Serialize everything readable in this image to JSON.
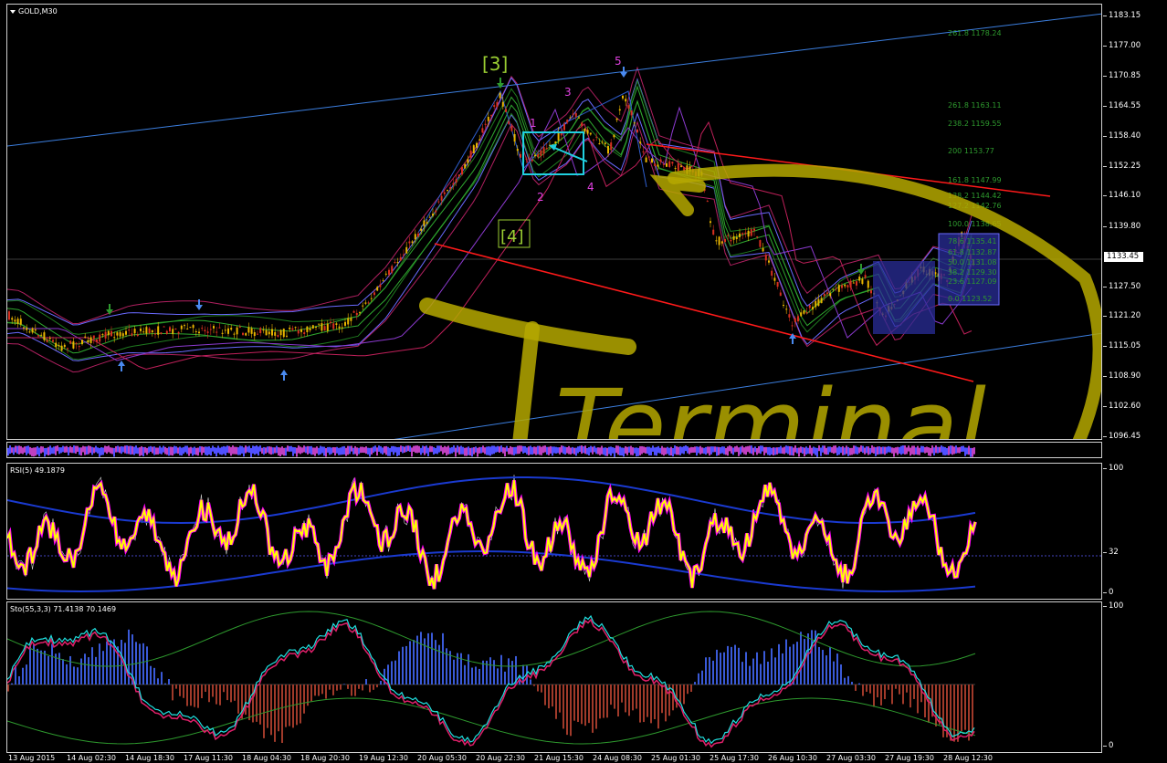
{
  "main": {
    "title": "GOLD,M30",
    "current_price": "1133.45",
    "price_ticks": [
      "1183.15",
      "1177.00",
      "1170.85",
      "1164.55",
      "1158.40",
      "1152.25",
      "1146.10",
      "1139.80",
      "1127.50",
      "1121.20",
      "1115.05",
      "1108.90",
      "1102.60",
      "1096.45"
    ],
    "wave_labels": [
      "[3]",
      "[4]",
      "1",
      "2",
      "3",
      "4",
      "5"
    ],
    "fib_labels": [
      "261.8 1178.24",
      "261.8 1163.11",
      "238.2 1159.55",
      "200 1153.77",
      "161.8 1147.99",
      "138.2 1144.42",
      "127.2 1142.76",
      "100.0 1138.65",
      "78.6 1135.41",
      "61.8 1132.87",
      "50.0 1131.08",
      "38.2 1129.30",
      "23.6 1127.09",
      "0.0 1123.52"
    ],
    "watermark": "Terminal"
  },
  "rsi": {
    "title": "RSI(5) 49.1879",
    "ticks": [
      "100",
      "32",
      "0"
    ]
  },
  "stoch": {
    "title": "Sto(55,3,3) 71.4138 70.1469",
    "ticks": [
      "100",
      "0"
    ]
  },
  "dates": [
    "13 Aug 2015",
    "14 Aug 02:30",
    "14 Aug 18:30",
    "17 Aug 11:30",
    "18 Aug 04:30",
    "18 Aug 20:30",
    "19 Aug 12:30",
    "20 Aug 05:30",
    "20 Aug 22:30",
    "21 Aug 15:30",
    "24 Aug 08:30",
    "25 Aug 01:30",
    "25 Aug 17:30",
    "26 Aug 10:30",
    "27 Aug 03:30",
    "27 Aug 19:30",
    "28 Aug 12:30"
  ],
  "colors": {
    "bull_candle": "#e8b400",
    "bear_candle": "#d83020",
    "trend_blue": "#3c7fe0",
    "trend_red": "#ff1a1a",
    "rsi_line": "#ffff00",
    "rsi_highlight": "#ff00ff",
    "watermark": "#b5a800",
    "fib": "#2e9a2e"
  }
}
